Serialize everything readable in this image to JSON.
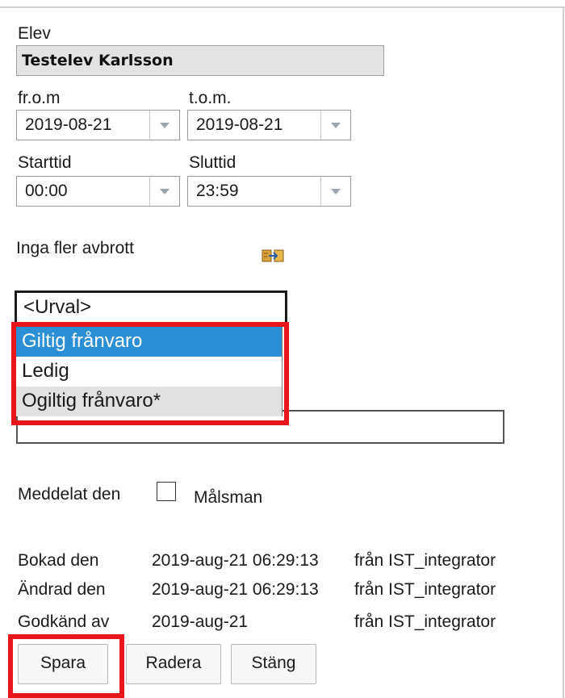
{
  "form": {
    "student_label": "Elev",
    "student_name": "Testelev Karlsson",
    "from_label": "fr.o.m",
    "from_value": "2019-08-21",
    "to_label": "t.o.m.",
    "to_value": "2019-08-21",
    "start_label": "Starttid",
    "start_value": "00:00",
    "end_label": "Sluttid",
    "end_value": "23:59",
    "no_more_breaks": "Inga fler avbrott",
    "reason_select": {
      "selected": "<Urval>",
      "options": [
        "Giltig frånvaro",
        "Ledig",
        "Ogiltig frånvaro*"
      ],
      "highlighted_option": "Giltig frånvaro"
    },
    "reported_label": "Meddelat den",
    "reported_checkbox_checked": false,
    "guardian_label": "Målsman"
  },
  "meta": {
    "booked_label": "Bokad den",
    "booked_value": "2019-aug-21 06:29:13",
    "booked_by": "från  IST_integrator",
    "changed_label": "Ändrad den",
    "changed_value": "2019-aug-21 06:29:13",
    "changed_by": "från  IST_integrator",
    "approved_label": "Godkänd av",
    "approved_value": "2019-aug-21",
    "approved_by": "från  IST_integrator"
  },
  "buttons": {
    "save": "Spara",
    "delete": "Radera",
    "close": "Stäng"
  },
  "colors": {
    "highlight_red": "#e8161b",
    "selected_option_bg": "#2b8fd6",
    "readonly_field_bg": "#e3e3e3"
  },
  "icons": {
    "transfer": "transfer-icon",
    "dropdown": "chevron-down-icon"
  }
}
